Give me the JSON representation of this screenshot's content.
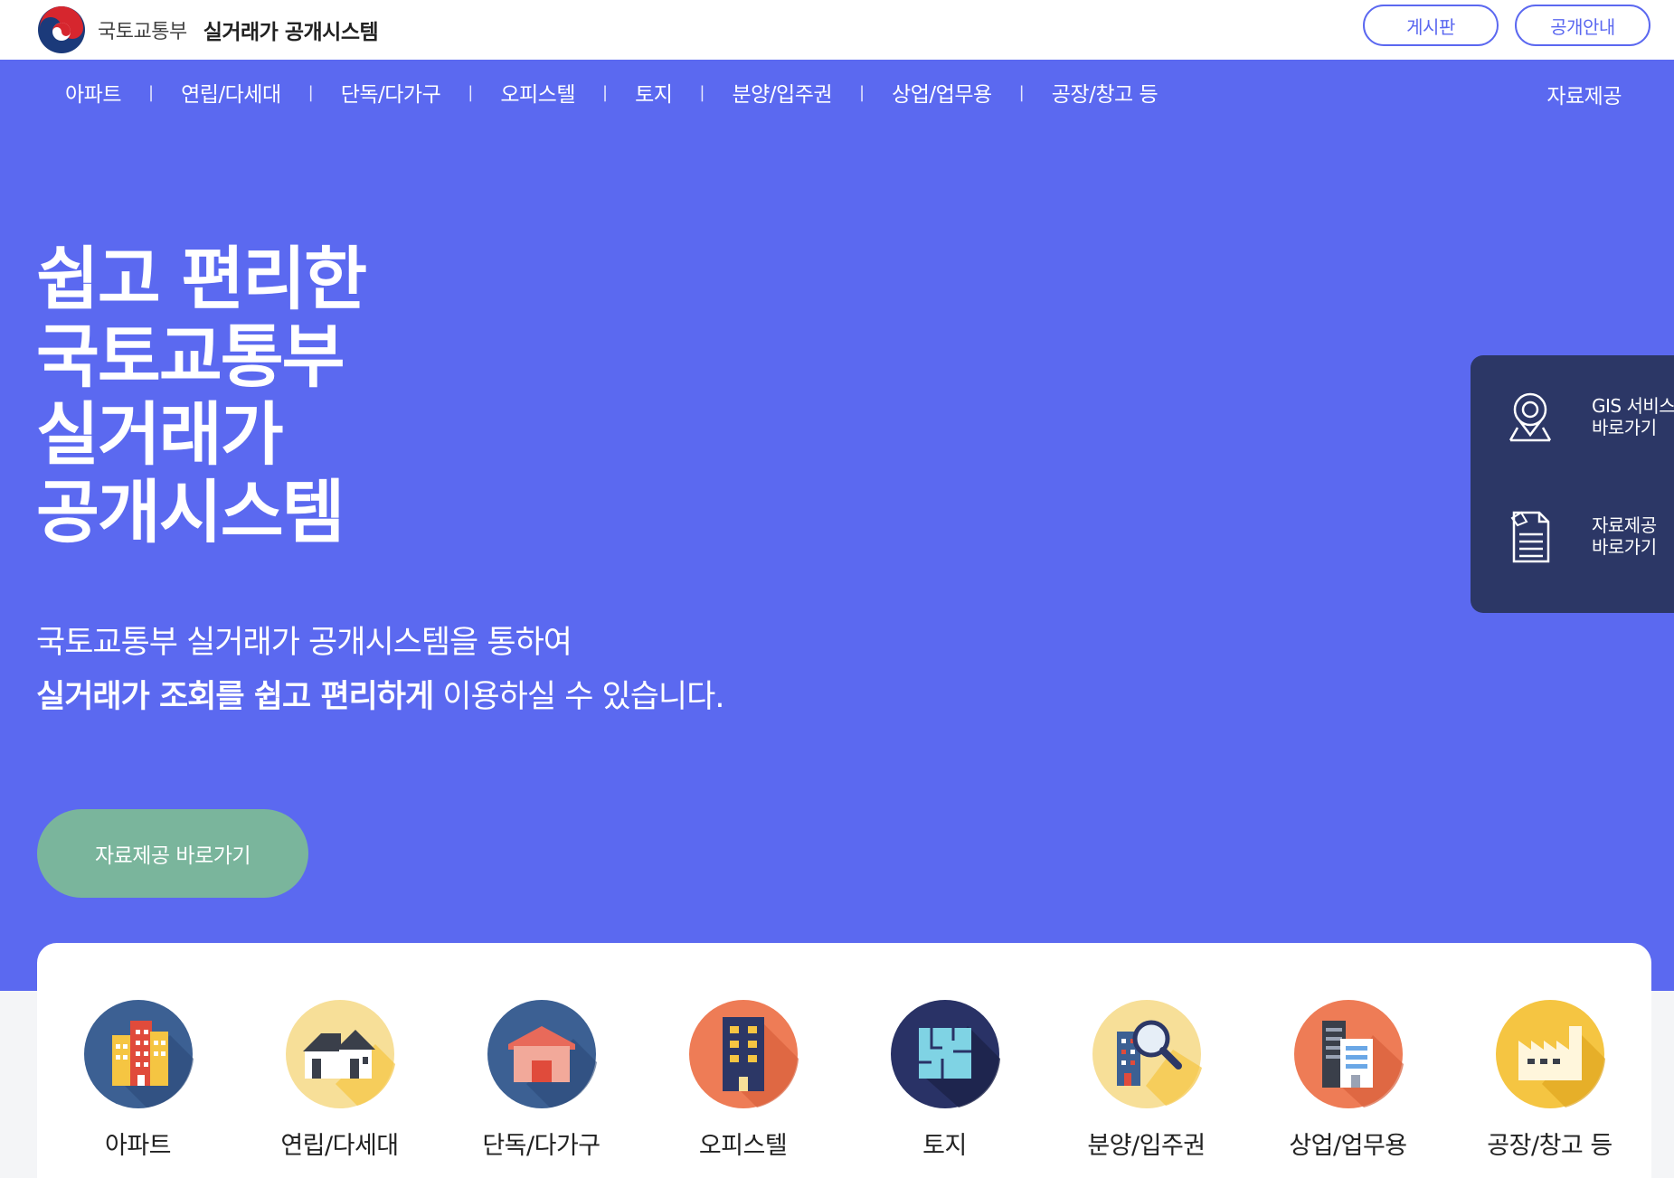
{
  "header": {
    "ministry": "국토교통부",
    "system_title": "실거래가 공개시스템",
    "board_label": "게시판",
    "guide_label": "공개안내"
  },
  "nav": {
    "items": [
      {
        "label": "아파트"
      },
      {
        "label": "연립/다세대"
      },
      {
        "label": "단독/다가구"
      },
      {
        "label": "오피스텔"
      },
      {
        "label": "토지"
      },
      {
        "label": "분양/입주권"
      },
      {
        "label": "상업/업무용"
      },
      {
        "label": "공장/창고 등"
      }
    ],
    "separator": "|",
    "data_label": "자료제공"
  },
  "hero": {
    "title_lines": [
      "쉽고 편리한",
      "국토교통부",
      "실거래가",
      "공개시스템"
    ],
    "desc_line1": "국토교통부 실거래가 공개시스템을 통하여",
    "desc_line2_bold": "실거래가 조회를 쉽고 편리하게",
    "desc_line2_rest": " 이용하실 수 있습니다.",
    "cta_label": "자료제공 바로가기"
  },
  "quick_panel": {
    "gis_line1": "GIS 서비스",
    "gis_line2": "바로가기",
    "data_line1": "자료제공",
    "data_line2": "바로가기"
  },
  "categories": [
    {
      "label": "아파트",
      "icon": "apartment-icon",
      "bg": "#3c6093"
    },
    {
      "label": "연립/다세대",
      "icon": "townhouse-icon",
      "bg": "#f7df98"
    },
    {
      "label": "단독/다가구",
      "icon": "house-icon",
      "bg": "#3c6093"
    },
    {
      "label": "오피스텔",
      "icon": "officetel-icon",
      "bg": "#ee7c56"
    },
    {
      "label": "토지",
      "icon": "land-icon",
      "bg": "#293266"
    },
    {
      "label": "분양/입주권",
      "icon": "presale-icon",
      "bg": "#f7df98"
    },
    {
      "label": "상업/업무용",
      "icon": "commercial-icon",
      "bg": "#ee7c56"
    },
    {
      "label": "공장/창고 등",
      "icon": "factory-icon",
      "bg": "#f5c542"
    }
  ],
  "colors": {
    "primary": "#5b69f0",
    "cta": "#7ab59c",
    "quick_panel": "#2c3766"
  }
}
